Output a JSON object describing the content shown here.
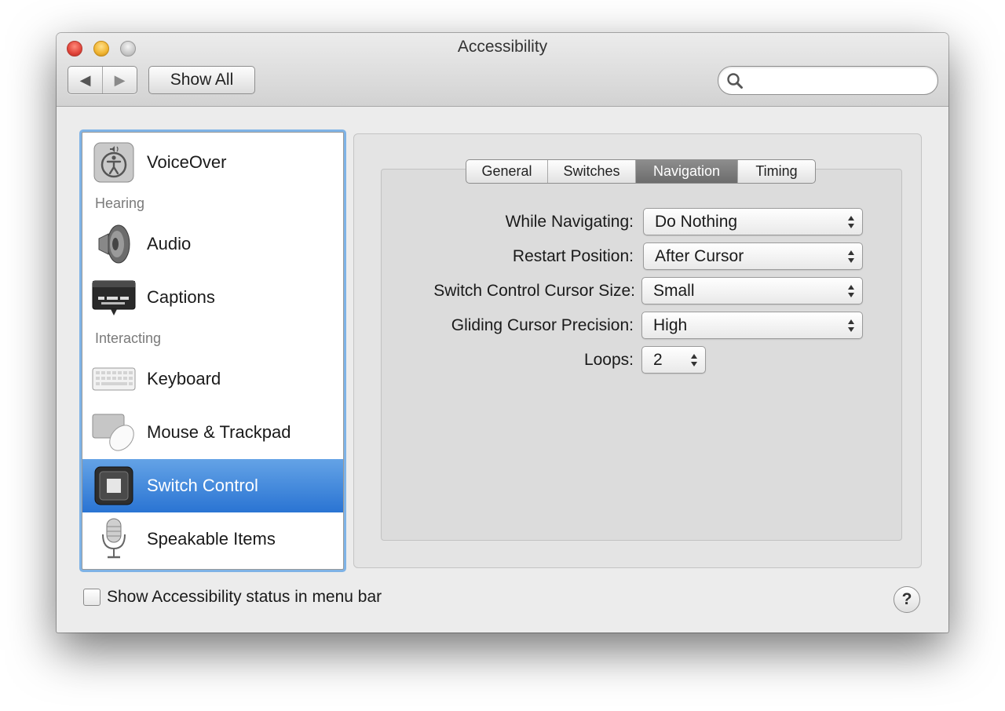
{
  "window": {
    "title": "Accessibility"
  },
  "toolbar": {
    "back_glyph": "◀",
    "forward_glyph": "▶",
    "show_all_label": "Show All",
    "search": {
      "value": "",
      "placeholder": ""
    }
  },
  "sidebar": {
    "items": [
      {
        "label": "VoiceOver",
        "icon": "voiceover-icon"
      },
      {
        "label": "Audio",
        "icon": "speaker-icon"
      },
      {
        "label": "Captions",
        "icon": "captions-icon"
      },
      {
        "label": "Keyboard",
        "icon": "keyboard-icon"
      },
      {
        "label": "Mouse & Trackpad",
        "icon": "mouse-trackpad-icon"
      },
      {
        "label": "Switch Control",
        "icon": "switch-control-icon",
        "selected": true
      },
      {
        "label": "Speakable Items",
        "icon": "microphone-icon"
      }
    ],
    "headers": {
      "hearing": "Hearing",
      "interacting": "Interacting"
    },
    "selection_color": "#2a74d3"
  },
  "tabs": {
    "items": [
      {
        "label": "General"
      },
      {
        "label": "Switches"
      },
      {
        "label": "Navigation",
        "active": true
      },
      {
        "label": "Timing"
      }
    ]
  },
  "navigation": {
    "while_navigating": {
      "label": "While Navigating:",
      "value": "Do Nothing"
    },
    "restart_position": {
      "label": "Restart Position:",
      "value": "After Cursor"
    },
    "cursor_size": {
      "label": "Switch Control Cursor Size:",
      "value": "Small"
    },
    "gliding_precision": {
      "label": "Gliding Cursor Precision:",
      "value": "High"
    },
    "loops": {
      "label": "Loops:",
      "value": "2"
    }
  },
  "footer": {
    "status_checkbox_label": "Show Accessibility status in menu bar",
    "status_checkbox_checked": false,
    "help_label": "?"
  }
}
